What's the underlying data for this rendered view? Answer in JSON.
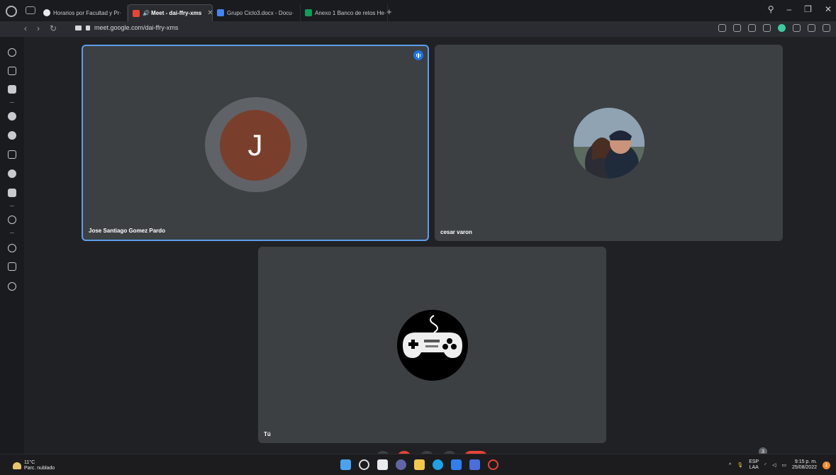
{
  "browser": {
    "tabs": [
      {
        "title": "Horarios por Facultad y Pr·",
        "favicon_color": "#e8eaed",
        "active": false
      },
      {
        "title": "🔊 Meet - dai-ffry-xms",
        "favicon_color": "#ea4335",
        "active": true
      },
      {
        "title": "Grupo Ciclo3.docx - Docu·",
        "favicon_color": "#4285f4",
        "active": false
      },
      {
        "title": "Anexo 1 Banco de retos He·",
        "favicon_color": "#0f9d58",
        "active": false
      }
    ],
    "url": "meet.google.com/dai-ffry-xms"
  },
  "meet": {
    "participants": [
      {
        "name": "Jose Santiago Gomez Pardo",
        "initial": "J",
        "avatar_color": "#7a3f2c",
        "speaking": true
      },
      {
        "name": "cesar varon",
        "avatar": "photo"
      },
      {
        "name": "Tú",
        "avatar": "gamepad-art"
      }
    ],
    "participant_count": "3"
  },
  "taskbar": {
    "weather_temp": "11°C",
    "weather_desc": "Parc. nublado",
    "lang_line1": "ESP",
    "lang_line2": "LAA",
    "time": "9:15 p. m.",
    "date": "25/08/2022",
    "notification_count": "1"
  },
  "colors": {
    "accent": "#5d9cec",
    "tile": "#3c4043",
    "background": "#202124",
    "hangup": "#ea4335"
  }
}
